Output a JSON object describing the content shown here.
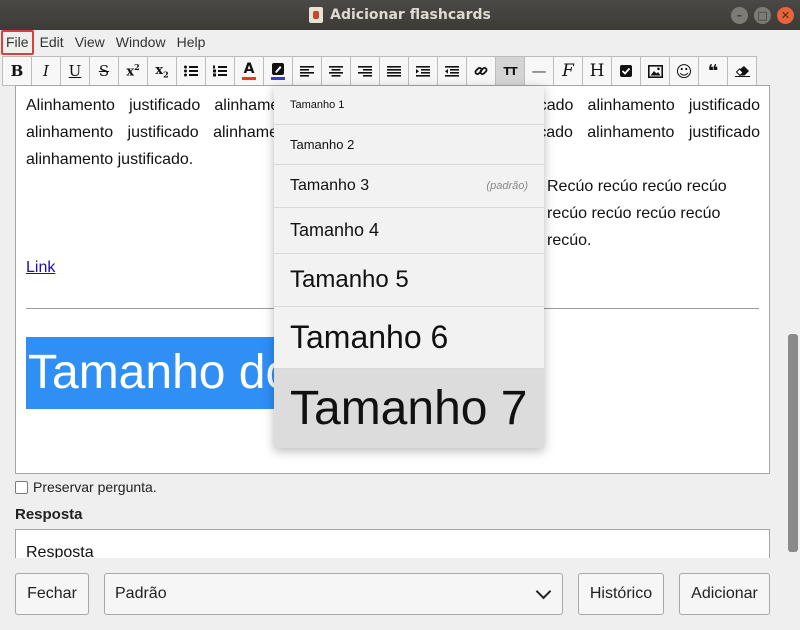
{
  "window": {
    "title": "Adicionar flashcards",
    "buttons": [
      "–",
      "□",
      "✕"
    ]
  },
  "menu": [
    "File",
    "Edit",
    "View",
    "Window",
    "Help"
  ],
  "toolbar": {
    "bold": "B",
    "italic": "I",
    "underline": "U",
    "strike": "S",
    "superscript_base": "x",
    "superscript_exp": "2",
    "subscript_base": "x",
    "subscript_exp": "2",
    "text_color_letter": "A",
    "font_size": "TT",
    "rule": "—",
    "function": "F",
    "heading": "H",
    "quote": "❝",
    "emoji": "☺",
    "text_color": "#e23a2a",
    "highlight_color": "#3a3adc"
  },
  "editor": {
    "justified_text": "Alinhamento justificado alinhamento justificado alinhamento justificado alinhamento justificado alinhamento justificado alinhamento justificado alinhamento justificado alinhamento justificado alinhamento justificado.",
    "indent_text": "Recúo recúo recúo recúo recúo recúo recúo recúo recúo.",
    "link_text": "Link",
    "big_text": "Tamanho do"
  },
  "font_size_menu": {
    "items": [
      {
        "label": "Tamanho 1",
        "note": ""
      },
      {
        "label": "Tamanho 2",
        "note": ""
      },
      {
        "label": "Tamanho 3",
        "note": "(padrão)"
      },
      {
        "label": "Tamanho 4",
        "note": ""
      },
      {
        "label": "Tamanho 5",
        "note": ""
      },
      {
        "label": "Tamanho 6",
        "note": ""
      },
      {
        "label": "Tamanho 7",
        "note": ""
      }
    ],
    "highlighted_item": "Tamanho 7"
  },
  "preserve_checkbox": {
    "label": "Preservar pergunta.",
    "checked": false
  },
  "answer": {
    "label": "Resposta",
    "value": "Resposta"
  },
  "bottom_bar": {
    "close": "Fechar",
    "deck_select": "Padrão",
    "history": "Histórico",
    "add": "Adicionar"
  }
}
